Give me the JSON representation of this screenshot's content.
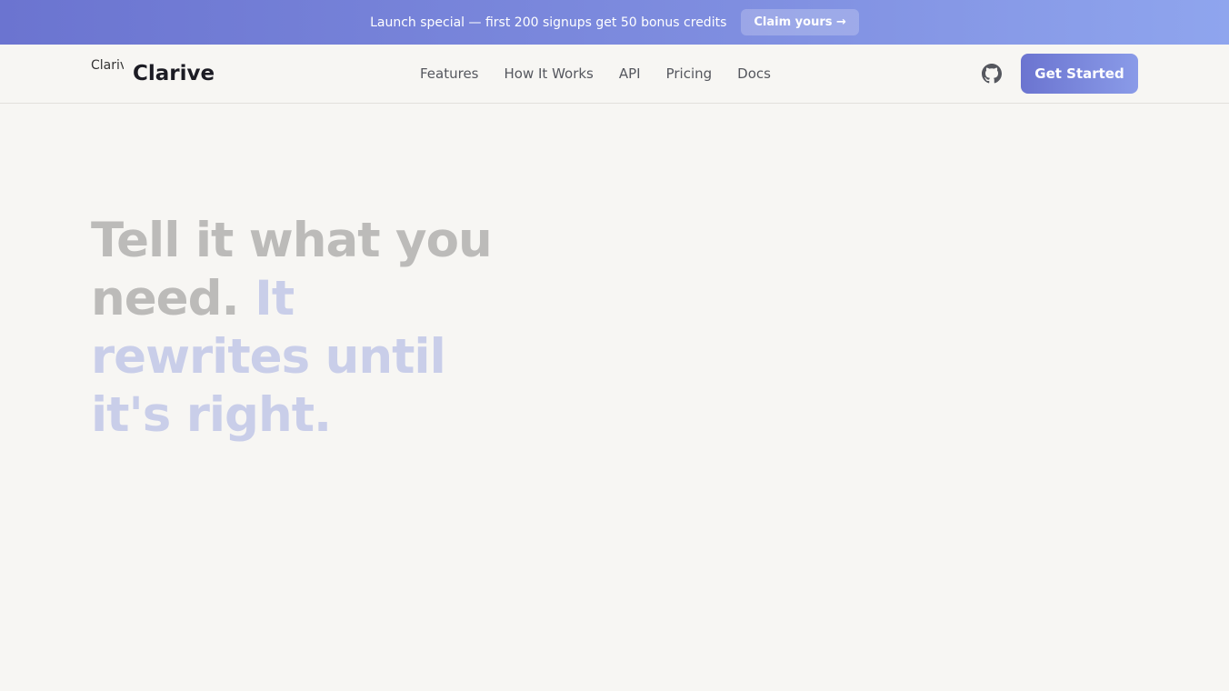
{
  "banner": {
    "text": "Launch special — first 200 signups get 50 bonus credits",
    "claim_label": "Claim yours →"
  },
  "header": {
    "logo_alt": "Clarive",
    "brand": "Clarive",
    "nav": [
      "Features",
      "How It Works",
      "API",
      "Pricing",
      "Docs"
    ],
    "github_icon": "github-icon",
    "cta_label": "Get Started"
  },
  "hero": {
    "title_plain": "Tell it what you need.",
    "title_accent": "It rewrites until it's right."
  },
  "colors": {
    "accent": "#6b74d0",
    "background": "#f7f6f3",
    "heading_muted": "#bcbbb9",
    "heading_accent": "#c9cee9"
  }
}
